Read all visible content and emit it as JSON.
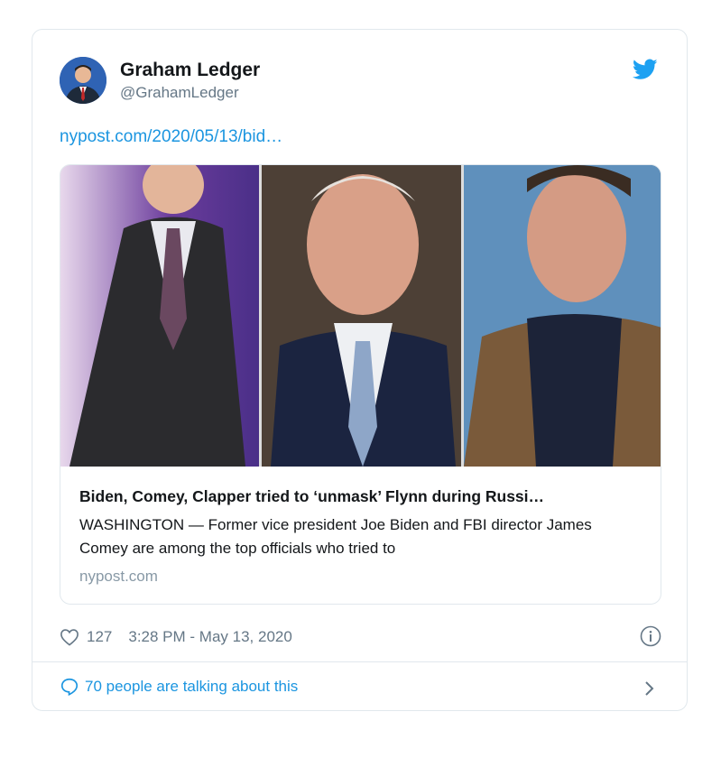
{
  "tweet": {
    "author_name": "Graham Ledger",
    "author_handle": "@GrahamLedger",
    "link_text": "nypost.com/2020/05/13/bid…",
    "card": {
      "title": "Biden, Comey, Clapper tried to ‘unmask’ Flynn during Russi…",
      "description": "WASHINGTON — Former vice president Joe Biden and FBI director James Comey are among the top officials who tried to",
      "domain": "nypost.com"
    },
    "like_count": "127",
    "timestamp": "3:28 PM - May 13, 2020",
    "talking_text": "70 people are talking about this"
  },
  "icons": {
    "brand": "twitter-bird-icon",
    "like": "heart-icon",
    "info": "info-icon",
    "reply": "speech-bubble-icon",
    "next": "chevron-right-icon"
  },
  "colors": {
    "accent": "#1b95e0",
    "secondary_text": "#657786",
    "border": "#e1e8ed"
  }
}
